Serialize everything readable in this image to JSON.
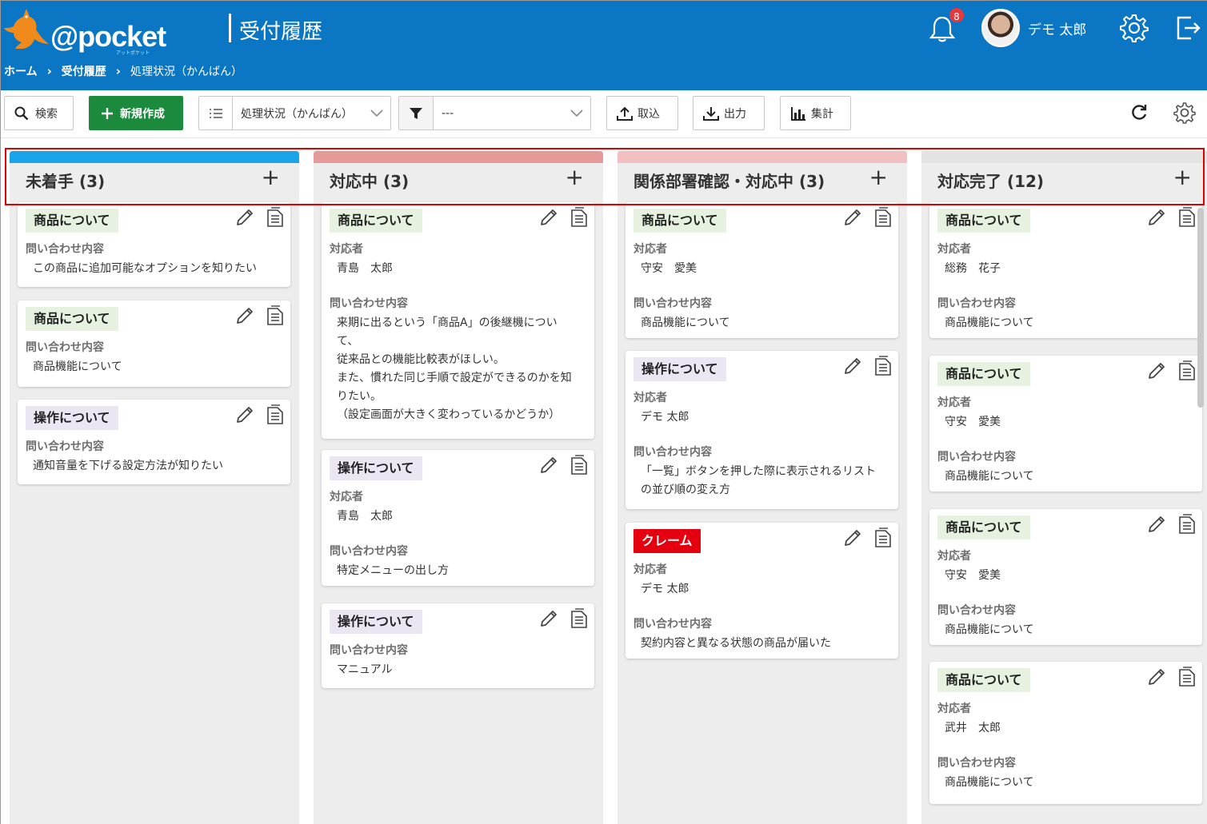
{
  "app": {
    "logo": "@pocket",
    "logo_sub": "アットポケット",
    "page_title": "受付履歴",
    "breadcrumb": [
      "ホーム",
      "受付履歴",
      "処理状況（かんばん）"
    ],
    "notifications": "8",
    "username": "デモ 太郎"
  },
  "toolbar": {
    "search": "検索",
    "new": "新規作成",
    "view": "処理状況（かんばん）",
    "filter": "---",
    "import": "取込",
    "export": "出力",
    "aggregate": "集計"
  },
  "colors": {
    "header": "#0a76c4",
    "not_started": "#1aa3e8",
    "in_progress": "#e59a9a",
    "dept_check": "#f2c0c0",
    "done": "#e3e3e3"
  },
  "columns": [
    {
      "title": "未着手 (3)",
      "cards": [
        {
          "tag": "商品について",
          "fields": [
            {
              "label": "問い合わせ内容",
              "value": "この商品に追加可能なオプションを知りたい"
            }
          ]
        },
        {
          "tag": "商品について",
          "fields": [
            {
              "label": "問い合わせ内容",
              "value": "商品機能について"
            }
          ]
        },
        {
          "tag": "操作について",
          "fields": [
            {
              "label": "問い合わせ内容",
              "value": "通知音量を下げる設定方法が知りたい"
            }
          ]
        }
      ]
    },
    {
      "title": "対応中 (3)",
      "cards": [
        {
          "tag": "商品について",
          "fields": [
            {
              "label": "対応者",
              "value": "青島　太郎"
            },
            {
              "label": "問い合わせ内容",
              "lines": [
                "来期に出るという「商品A」の後継機につい",
                "て、",
                "従来品との機能比較表がほしい。",
                "また、慣れた同じ手順で設定ができるのかを知",
                "りたい。",
                "（設定画面が大きく変わっているかどうか）"
              ]
            }
          ]
        },
        {
          "tag": "操作について",
          "fields": [
            {
              "label": "対応者",
              "value": "青島　太郎"
            },
            {
              "label": "問い合わせ内容",
              "value": "特定メニューの出し方"
            }
          ]
        },
        {
          "tag": "操作について",
          "fields": [
            {
              "label": "問い合わせ内容",
              "value": "マニュアル"
            }
          ]
        }
      ]
    },
    {
      "title": "関係部署確認・対応中 (3)",
      "cards": [
        {
          "tag": "商品について",
          "fields": [
            {
              "label": "対応者",
              "value": "守安　愛美"
            },
            {
              "label": "問い合わせ内容",
              "value": "商品機能について"
            }
          ]
        },
        {
          "tag": "操作について",
          "fields": [
            {
              "label": "対応者",
              "value": "デモ 太郎"
            },
            {
              "label": "問い合わせ内容",
              "lines": [
                "「一覧」ボタンを押した際に表示されるリスト",
                "の並び順の変え方"
              ]
            }
          ]
        },
        {
          "tag": "クレーム",
          "fields": [
            {
              "label": "対応者",
              "value": "デモ 太郎"
            },
            {
              "label": "問い合わせ内容",
              "value": "契約内容と異なる状態の商品が届いた"
            }
          ]
        }
      ]
    },
    {
      "title": "対応完了 (12)",
      "cards": [
        {
          "tag": "商品について",
          "fields": [
            {
              "label": "対応者",
              "value": "総務　花子"
            },
            {
              "label": "問い合わせ内容",
              "value": "商品機能について"
            }
          ]
        },
        {
          "tag": "商品について",
          "fields": [
            {
              "label": "対応者",
              "value": "守安　愛美"
            },
            {
              "label": "問い合わせ内容",
              "value": "商品機能について"
            }
          ]
        },
        {
          "tag": "商品について",
          "fields": [
            {
              "label": "対応者",
              "value": "守安　愛美"
            },
            {
              "label": "問い合わせ内容",
              "value": "商品機能について"
            }
          ]
        },
        {
          "tag": "商品について",
          "fields": [
            {
              "label": "対応者",
              "value": "武井　太郎"
            },
            {
              "label": "問い合わせ内容",
              "value": "商品機能について"
            }
          ]
        }
      ]
    }
  ]
}
